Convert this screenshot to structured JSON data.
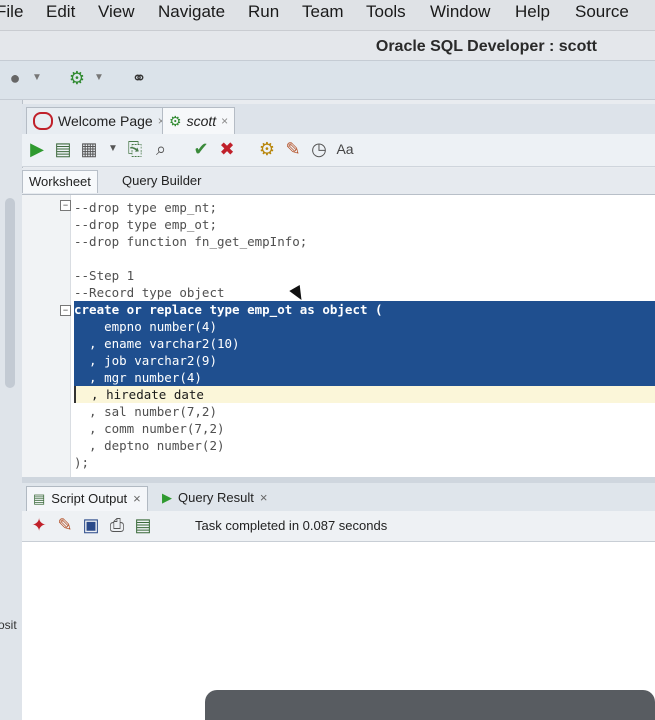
{
  "menu": [
    "File",
    "Edit",
    "View",
    "Navigate",
    "Run",
    "Team",
    "Tools",
    "Window",
    "Help",
    "Source"
  ],
  "window_title": "Oracle SQL Developer : scott",
  "left_label": "osit",
  "doc_tabs": [
    {
      "label": "Welcome Page",
      "close": "×",
      "icon": "record-icon"
    },
    {
      "label": "scott",
      "close": "×",
      "icon": "sql-icon"
    }
  ],
  "worksheet_tabs": [
    "Worksheet",
    "Query Builder"
  ],
  "code": [
    {
      "text": "--drop type emp_nt;",
      "state": "normal"
    },
    {
      "text": "--drop type emp_ot;",
      "state": "normal"
    },
    {
      "text": "--drop function fn_get_empInfo;",
      "state": "normal"
    },
    {
      "text": "",
      "state": "normal"
    },
    {
      "text": "--Step 1",
      "state": "normal"
    },
    {
      "text": "--Record type object",
      "state": "normal"
    },
    {
      "text": "create or replace type emp_ot as object (",
      "state": "sel"
    },
    {
      "text": "    empno number(4)",
      "state": "sel"
    },
    {
      "text": "  , ename varchar2(10)",
      "state": "sel"
    },
    {
      "text": "  , job varchar2(9)",
      "state": "sel"
    },
    {
      "text": "  , mgr number(4)",
      "state": "sel"
    },
    {
      "text": "  , hiredate date",
      "state": "cur"
    },
    {
      "text": "  , sal number(7,2)",
      "state": "normal"
    },
    {
      "text": "  , comm number(7,2)",
      "state": "normal"
    },
    {
      "text": "  , deptno number(2)",
      "state": "normal"
    },
    {
      "text": ");",
      "state": "normal"
    }
  ],
  "output_tabs": [
    {
      "label": "Script Output",
      "close": "×"
    },
    {
      "label": "Query Result",
      "close": "×"
    }
  ],
  "status_text": "Task completed in 0.087 seconds",
  "colors": {
    "selection": "#1f4f8f",
    "run_green": "#2f9a2f",
    "accent_red": "#c0202a"
  }
}
